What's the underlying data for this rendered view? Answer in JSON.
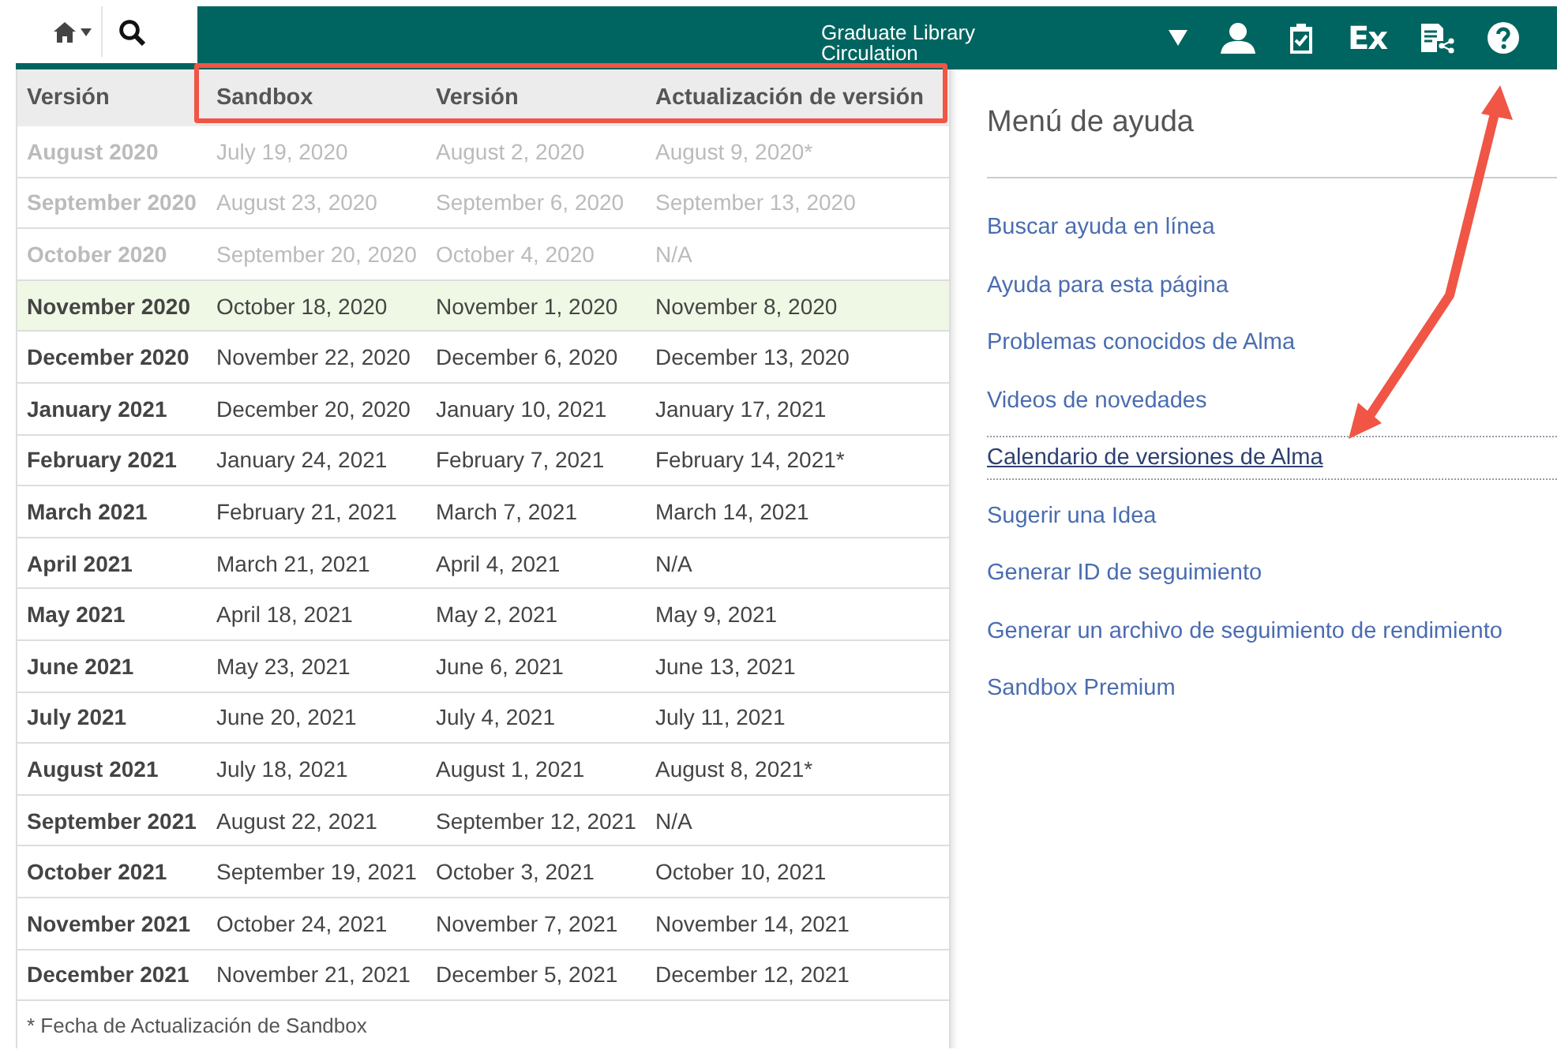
{
  "top_bar": {
    "library_lines": [
      "Graduate Library",
      "Circulation"
    ],
    "ex_label": "Ex"
  },
  "table": {
    "columns": [
      "Versión",
      "Sandbox",
      "Versión",
      "Actualización de versión"
    ],
    "rows": [
      {
        "cells": [
          "August 2020",
          "July 19, 2020",
          "August 2, 2020",
          "August 9, 2020*"
        ],
        "past": true,
        "selected": false
      },
      {
        "cells": [
          "September 2020",
          "August 23, 2020",
          "September 6, 2020",
          "September 13, 2020"
        ],
        "past": true,
        "selected": false
      },
      {
        "cells": [
          "October 2020",
          "September 20, 2020",
          "October 4, 2020",
          "N/A"
        ],
        "past": true,
        "selected": false
      },
      {
        "cells": [
          "November 2020",
          "October 18, 2020",
          "November 1, 2020",
          "November 8, 2020"
        ],
        "past": false,
        "selected": true
      },
      {
        "cells": [
          "December 2020",
          "November 22, 2020",
          "December 6, 2020",
          "December 13, 2020"
        ],
        "past": false,
        "selected": false
      },
      {
        "cells": [
          "January 2021",
          "December 20, 2020",
          "January 10, 2021",
          "January 17, 2021"
        ],
        "past": false,
        "selected": false
      },
      {
        "cells": [
          "February 2021",
          "January 24, 2021",
          "February 7, 2021",
          "February 14, 2021*"
        ],
        "past": false,
        "selected": false
      },
      {
        "cells": [
          "March 2021",
          "February 21, 2021",
          "March 7, 2021",
          "March 14, 2021"
        ],
        "past": false,
        "selected": false
      },
      {
        "cells": [
          "April 2021",
          "March 21, 2021",
          "April 4, 2021",
          "N/A"
        ],
        "past": false,
        "selected": false
      },
      {
        "cells": [
          "May 2021",
          "April 18, 2021",
          "May 2, 2021",
          "May 9, 2021"
        ],
        "past": false,
        "selected": false
      },
      {
        "cells": [
          "June 2021",
          "May 23, 2021",
          "June 6, 2021",
          "June 13, 2021"
        ],
        "past": false,
        "selected": false
      },
      {
        "cells": [
          "July 2021",
          "June 20, 2021",
          "July 4, 2021",
          "July 11, 2021"
        ],
        "past": false,
        "selected": false
      },
      {
        "cells": [
          "August 2021",
          "July 18, 2021",
          "August 1, 2021",
          "August 8, 2021*"
        ],
        "past": false,
        "selected": false
      },
      {
        "cells": [
          "September 2021",
          "August 22, 2021",
          "September 12, 2021",
          "N/A"
        ],
        "past": false,
        "selected": false
      },
      {
        "cells": [
          "October 2021",
          "September 19, 2021",
          "October 3, 2021",
          "October 10, 2021"
        ],
        "past": false,
        "selected": false
      },
      {
        "cells": [
          "November 2021",
          "October 24, 2021",
          "November 7, 2021",
          "November 14, 2021"
        ],
        "past": false,
        "selected": false
      },
      {
        "cells": [
          "December 2021",
          "November 21, 2021",
          "December 5, 2021",
          "December 12, 2021"
        ],
        "past": false,
        "selected": false
      }
    ],
    "footnote": "* Fecha de Actualización de Sandbox"
  },
  "help_menu": {
    "title": "Menú de ayuda",
    "items": [
      {
        "label": "Buscar ayuda en línea",
        "selected": false
      },
      {
        "label": "Ayuda para esta página",
        "selected": false
      },
      {
        "label": "Problemas conocidos de Alma",
        "selected": false
      },
      {
        "label": "Videos de novedades",
        "selected": false
      },
      {
        "label": "Calendario de versiones de Alma",
        "selected": true
      },
      {
        "label": "Sugerir una Idea",
        "selected": false
      },
      {
        "label": "Generar ID de seguimiento",
        "selected": false
      },
      {
        "label": "Generar un archivo de seguimiento de rendimiento",
        "selected": false
      },
      {
        "label": "Sandbox Premium",
        "selected": false
      }
    ]
  }
}
